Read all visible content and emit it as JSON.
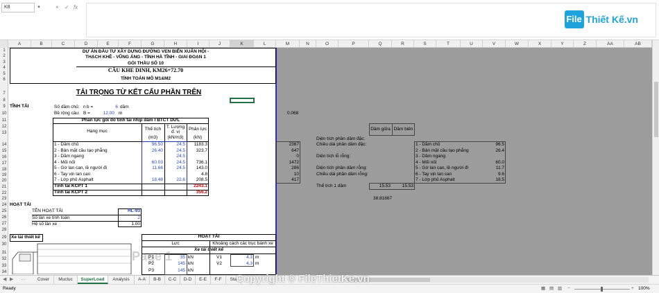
{
  "formula_bar": {
    "name_box": "K8",
    "cancel_icon": "×",
    "enter_icon": "✓",
    "fx": "fx"
  },
  "logo": {
    "icon_text": "File",
    "name": "Thiết Kế.vn"
  },
  "columns": [
    "A",
    "B",
    "C",
    "D",
    "E",
    "F",
    "G",
    "H",
    "I",
    "J",
    "K",
    "L",
    "M",
    "N",
    "O",
    "P",
    "Q",
    "R",
    "S",
    "T",
    "U",
    "V",
    "W",
    "X",
    "Y",
    "Z",
    "AA",
    "AB"
  ],
  "rows": [
    "1",
    "2",
    "3",
    "4",
    "5",
    "6",
    "7",
    "8",
    "9",
    "10",
    "11",
    "12",
    "13",
    "14",
    "15",
    "16",
    "17",
    "18",
    "19",
    "20",
    "21",
    "22",
    "23",
    "24",
    "25",
    "26",
    "27",
    "28",
    "29",
    "30",
    "31",
    "32",
    "33",
    "34"
  ],
  "sheet": {
    "h1": "DỰ ÁN ĐẦU TƯ XÂY DỰNG ĐƯỜNG VEN BIỂN XUÂN HỘI -",
    "h2": "THẠCH KHÊ - VŨNG ÁNG - TỈNH HÀ TĨNH - GIAI ĐOẠN 1",
    "h3": "GÓI THẦU SỐ 10",
    "h4": "CẦU KHE DINH, KM26+72.70",
    "h5": "TÍNH TOÁN MỐ M1&M2",
    "title": "TẢI TRỌNG TỪ KẾT CẤU PHẦN TRÊN",
    "tinh_tai": "TĨNH TẢI",
    "so_dam_chu": "Số dầm chủ:",
    "nb": "n b =",
    "nb_val": "6",
    "dam": "dầm",
    "be_rong": "Bề rộng cầu:",
    "B": "B =",
    "B_val": "12.00",
    "m": "m",
    "table_title": "Phản lực gối do tĩnh tải nhịp dầm I BTCT DƯL",
    "col_hang_muc": "Hạng mục",
    "col_the_tich": "Thể tích",
    "col_the_tich_u": "(m3)",
    "col_tl": "T. Lượng",
    "col_tl2": "đ. vị",
    "col_tl_u": "(kN/m3)",
    "col_pl": "Phản lực",
    "col_pl_u": "(kN)",
    "items": [
      {
        "name": "1 - Dầm chủ",
        "vol": "96.50",
        "w": "24.5",
        "r": "1183.3"
      },
      {
        "name": "2 - Bản mặt cầu tạo phẳng",
        "vol": "26.40",
        "w": "24.5",
        "r": "323.7"
      },
      {
        "name": "3 - Dầm ngang",
        "vol": "",
        "w": "24.5",
        "r": ""
      },
      {
        "name": "4 - Mối nối",
        "vol": "60.03",
        "w": "24.5",
        "r": "736.1"
      },
      {
        "name": "5 - Gờ lan can, lề người đi",
        "vol": "11.66",
        "w": "24.5",
        "r": "143.0"
      },
      {
        "name": "6 - Tay vịn lan can",
        "vol": "",
        "w": "",
        "r": "4.8"
      },
      {
        "name": "7 - Lớp phủ Asphalt",
        "vol": "18.48",
        "w": "22.6",
        "r": "208.5"
      }
    ],
    "kcpt1": "Tĩnh tải KCPT 1",
    "kcpt1_val": "2243.1",
    "kcpt2": "Tĩnh tải KCPT 2",
    "kcpt2_val": "356.2",
    "hoat_tai": "HOẠT TẢI",
    "ten_hoat_tai": "TÊN HOẠT TẢI",
    "hl93": "HL-93",
    "so_lan": "Số làn xe tính toán",
    "so_lan_val": "2",
    "he_so": "Hệ số làn xe",
    "he_so_val": "1.00",
    "xe_tai": "Xe tải thiết kế",
    "ht_title": "HOẠT TẢI",
    "luc": "Lực",
    "kc": "Khoảng cách các trục bánh xe",
    "xe_tai_tk": "Xe tải thiết kế",
    "p1": "P1",
    "p1_val": "35",
    "p2": "P2",
    "p2_val": "145",
    "p3": "P3",
    "p3_val": "145",
    "kN": "kN",
    "v1": "V1",
    "v1_val": "4.3",
    "v2": "V2",
    "v2_val": "4.3"
  },
  "right": {
    "n10": "0.068",
    "m_vals": [
      "2367",
      "647",
      "0",
      "1472",
      "286",
      "10",
      "417"
    ],
    "dam_giua": "Dầm giữa",
    "dam_bien": "Dầm biên",
    "labels": [
      "Diện tích phần dầm đặc:",
      "Chiều dài phần dầm đặc:",
      "Diện tích lỗ rỗng:",
      "Diện tích phần dầm rỗng:",
      "Chiều dài phần dầm rỗng:",
      "Thể tích 1 dầm"
    ],
    "tt1": "15.53",
    "tt2": "15.53",
    "v23": "38.81667",
    "items": [
      {
        "name": "1 - Dầm chủ",
        "v": "96.5"
      },
      {
        "name": "2 - Bản mặt cầu tạo phẳng",
        "v": "26.4"
      },
      {
        "name": "3 - Dầm ngang",
        "v": ""
      },
      {
        "name": "4 - Mối nối",
        "v": "60.0"
      },
      {
        "name": "5 - Gờ lan can, lề người đi",
        "v": "11.7"
      },
      {
        "name": "6 - Tay vịn lan can",
        "v": "9.6"
      },
      {
        "name": "7 - Lớp phủ Asphalt",
        "v": "18.5"
      }
    ]
  },
  "tabs": [
    "Cover",
    "Mucluc",
    "SuperLoad",
    "Analysis",
    "A-A",
    "B-B",
    "C-C",
    "D-D",
    "E-E",
    "F-F",
    "Sta"
  ],
  "active_tab": "SuperLoad",
  "status": {
    "ready": "Ready",
    "zoom": "100%"
  },
  "watermark": "Copyright © FileThietKe.vn",
  "watermark2": "Page 1"
}
